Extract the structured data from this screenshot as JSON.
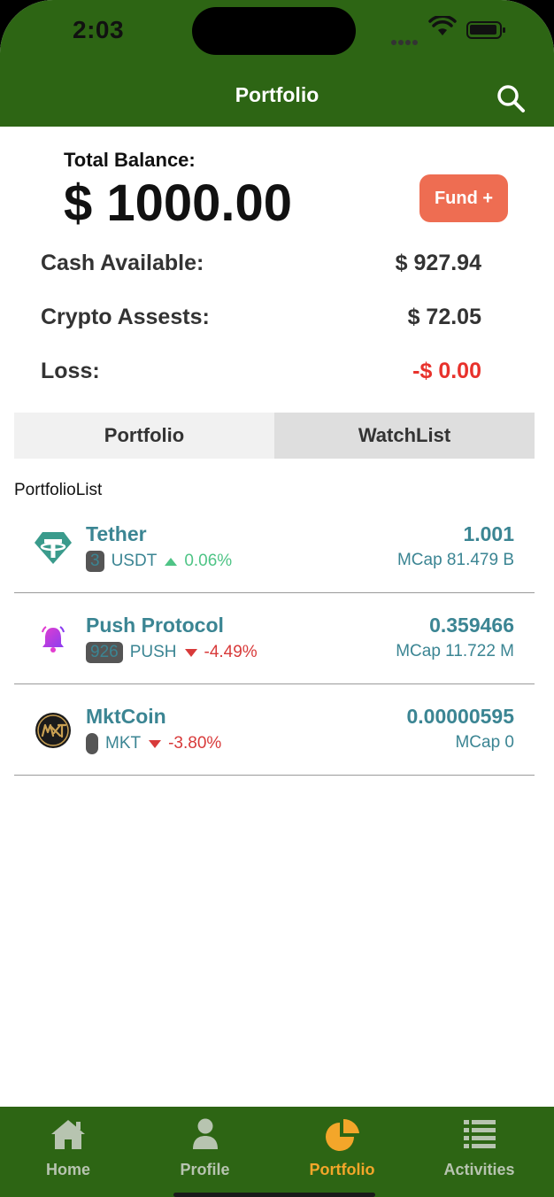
{
  "status_bar": {
    "time": "2:03"
  },
  "header": {
    "title": "Portfolio"
  },
  "balance": {
    "total_label": "Total Balance:",
    "total_value": "$ 1000.00",
    "fund_button": "Fund +",
    "rows": [
      {
        "label": "Cash Available:",
        "value": "$ 927.94"
      },
      {
        "label": "Crypto Assests:",
        "value": "$ 72.05"
      },
      {
        "label": "Loss:",
        "value": "-$ 0.00"
      }
    ]
  },
  "tabs": [
    {
      "label": "Portfolio",
      "active": true
    },
    {
      "label": "WatchList",
      "active": false
    }
  ],
  "section_label": "PortfolioList",
  "coins": [
    {
      "name": "Tether",
      "rank": "3",
      "symbol": "USDT",
      "change": "0.06%",
      "direction": "up",
      "price": "1.001",
      "mcap": "MCap 81.479 B",
      "icon": "tether-icon"
    },
    {
      "name": "Push Protocol",
      "rank": "926",
      "symbol": "PUSH",
      "change": "-4.49%",
      "direction": "down",
      "price": "0.359466",
      "mcap": "MCap 11.722 M",
      "icon": "bell-icon"
    },
    {
      "name": "MktCoin",
      "rank": "",
      "symbol": "MKT",
      "change": "-3.80%",
      "direction": "down",
      "price": "0.00000595",
      "mcap": "MCap 0",
      "icon": "mkt-logo-icon"
    }
  ],
  "bottom_nav": [
    {
      "label": "Home",
      "icon": "home-icon",
      "active": false
    },
    {
      "label": "Profile",
      "icon": "person-icon",
      "active": false
    },
    {
      "label": "Portfolio",
      "icon": "pie-chart-icon",
      "active": true
    },
    {
      "label": "Activities",
      "icon": "list-icon",
      "active": false
    }
  ],
  "colors": {
    "brand_green": "#2d6514",
    "accent_orange": "#f3a62a",
    "fund_button": "#ee6d52",
    "coin_teal": "#3b8593",
    "loss_red": "#e8322c",
    "up_green": "#4fc486",
    "down_red": "#d83a3a"
  }
}
